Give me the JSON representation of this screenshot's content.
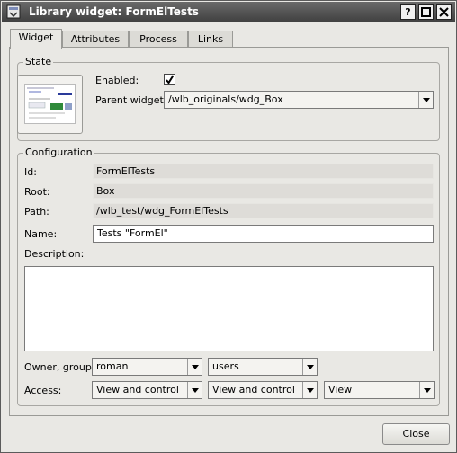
{
  "window": {
    "title": "Library widget: FormElTests",
    "help_label": "?",
    "maximize_label": "□",
    "close_label": "X"
  },
  "tabs": [
    {
      "label": "Widget",
      "active": true
    },
    {
      "label": "Attributes",
      "active": false
    },
    {
      "label": "Process",
      "active": false
    },
    {
      "label": "Links",
      "active": false
    }
  ],
  "state": {
    "title": "State",
    "enabled_label": "Enabled:",
    "enabled_checked": true,
    "parent_label": "Parent widget:",
    "parent_value": "/wlb_originals/wdg_Box"
  },
  "config": {
    "title": "Configuration",
    "id_label": "Id:",
    "id_value": "FormElTests",
    "root_label": "Root:",
    "root_value": "Box",
    "path_label": "Path:",
    "path_value": "/wlb_test/wdg_FormElTests",
    "name_label": "Name:",
    "name_value": "Tests \"FormEl\"",
    "description_label": "Description:",
    "description_value": "",
    "owner_label": "Owner, group:",
    "owner_value": "roman",
    "group_value": "users",
    "access_label": "Access:",
    "access_owner": "View and control",
    "access_group": "View and control",
    "access_other": "View"
  },
  "buttons": {
    "close": "Close"
  },
  "colors": {
    "titlebar": "#4a4a4a",
    "window_bg": "#e9e8e4",
    "readonly_bg": "#dedcd8"
  }
}
